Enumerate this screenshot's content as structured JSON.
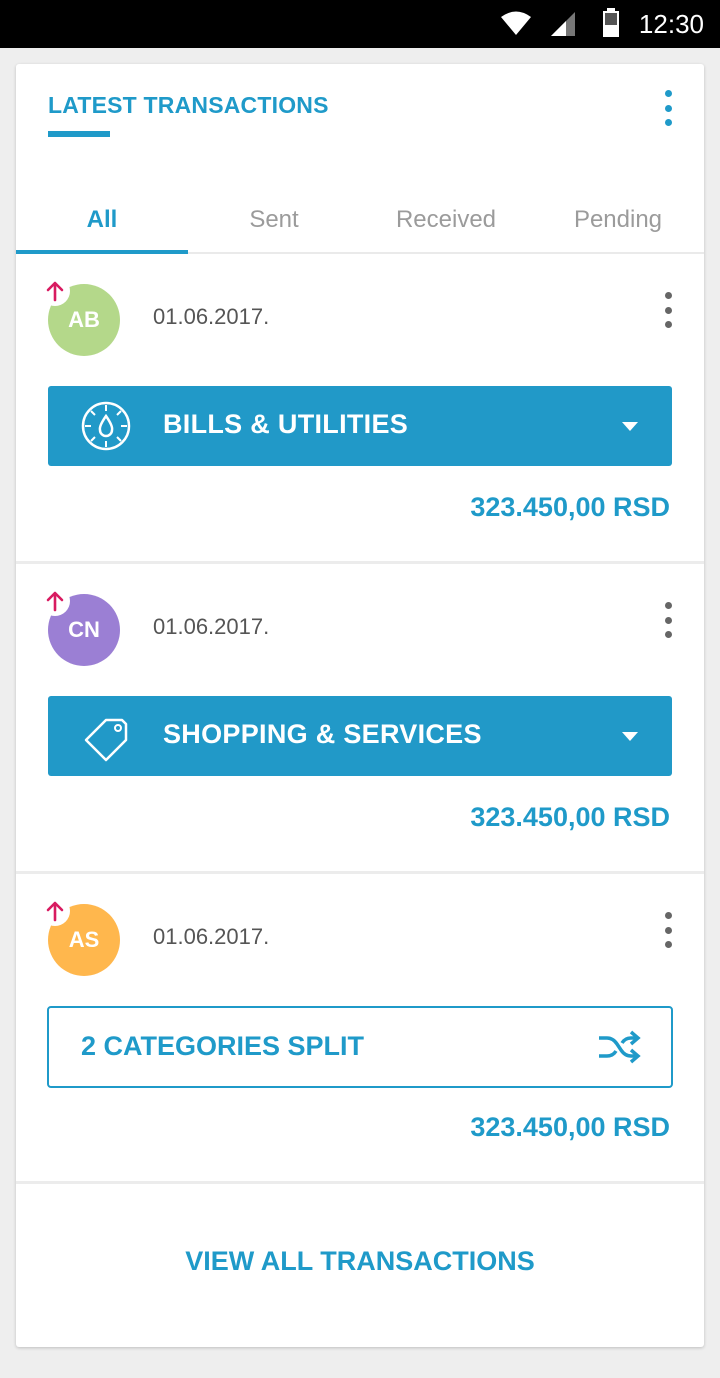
{
  "status_bar": {
    "time": "12:30",
    "icons": [
      "wifi-icon",
      "signal-icon",
      "battery-icon"
    ]
  },
  "header": {
    "title": "LATEST TRANSACTIONS"
  },
  "tabs": [
    {
      "label": "All",
      "active": true
    },
    {
      "label": "Sent",
      "active": false
    },
    {
      "label": "Received",
      "active": false
    },
    {
      "label": "Pending",
      "active": false
    }
  ],
  "transactions": [
    {
      "initials": "AB",
      "avatar_color": "#b4d88a",
      "direction": "sent",
      "date": "01.06.2017.",
      "category": "BILLS & UTILITIES",
      "category_icon": "water-drop-icon",
      "amount": "323.450,00 RSD"
    },
    {
      "initials": "CN",
      "avatar_color": "#9b7fd4",
      "direction": "sent",
      "date": "01.06.2017.",
      "category": "SHOPPING & SERVICES",
      "category_icon": "price-tag-icon",
      "amount": "323.450,00 RSD"
    },
    {
      "initials": "AS",
      "avatar_color": "#ffb74d",
      "direction": "sent",
      "date": "01.06.2017.",
      "split_label": "2 CATEGORIES SPLIT",
      "split_icon": "shuffle-icon",
      "amount": "323.450,00 RSD"
    }
  ],
  "footer": {
    "view_all": "VIEW ALL TRANSACTIONS"
  },
  "colors": {
    "accent": "#1f9ac9",
    "category_button": "#2199c8",
    "sent_arrow": "#d81b60"
  }
}
